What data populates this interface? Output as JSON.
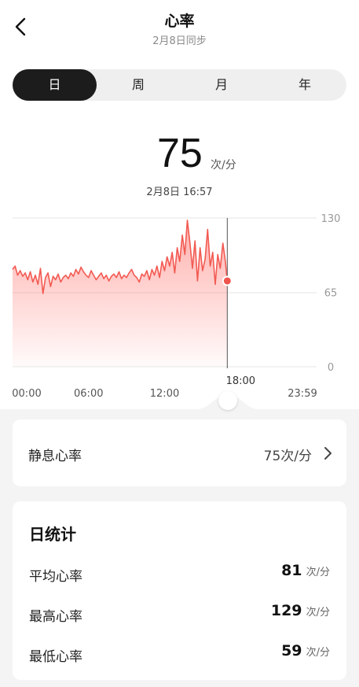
{
  "header": {
    "title": "心率",
    "subtitle": "2月8日同步"
  },
  "tabs": [
    {
      "label": "日",
      "active": true
    },
    {
      "label": "周",
      "active": false
    },
    {
      "label": "月",
      "active": false
    },
    {
      "label": "年",
      "active": false
    }
  ],
  "current": {
    "value": "75",
    "unit": "次/分",
    "time": "2月8日 16:57"
  },
  "chart_data": {
    "type": "area",
    "ylim": [
      0,
      130
    ],
    "y_ticks": [
      "130",
      "65",
      "0"
    ],
    "x_ticks": [
      "00:00",
      "06:00",
      "12:00",
      "23:59"
    ],
    "cursor_label": "18:00",
    "x_range_hours": [
      0,
      24
    ],
    "x": [
      0.0,
      0.2,
      0.4,
      0.6,
      0.8,
      1.0,
      1.2,
      1.4,
      1.6,
      1.8,
      2.0,
      2.2,
      2.4,
      2.6,
      2.8,
      3.0,
      3.2,
      3.4,
      3.6,
      3.8,
      4.0,
      4.2,
      4.4,
      4.6,
      4.8,
      5.0,
      5.2,
      5.4,
      5.6,
      5.8,
      6.0,
      6.2,
      6.4,
      6.6,
      6.8,
      7.0,
      7.2,
      7.4,
      7.6,
      7.8,
      8.0,
      8.2,
      8.4,
      8.6,
      8.8,
      9.0,
      9.2,
      9.4,
      9.6,
      9.8,
      10.0,
      10.2,
      10.4,
      10.6,
      10.8,
      11.0,
      11.2,
      11.4,
      11.6,
      11.8,
      12.0,
      12.2,
      12.4,
      12.6,
      12.8,
      13.0,
      13.2,
      13.4,
      13.6,
      13.8,
      14.0,
      14.2,
      14.4,
      14.6,
      14.8,
      15.0,
      15.2,
      15.4,
      15.6,
      15.8,
      16.0,
      16.2,
      16.4,
      16.6,
      16.8,
      16.95
    ],
    "y": [
      85,
      88,
      80,
      84,
      79,
      82,
      76,
      83,
      74,
      80,
      72,
      86,
      64,
      78,
      82,
      70,
      79,
      76,
      81,
      74,
      78,
      80,
      77,
      82,
      79,
      85,
      81,
      87,
      83,
      80,
      78,
      84,
      80,
      76,
      79,
      82,
      77,
      80,
      75,
      79,
      81,
      78,
      83,
      77,
      80,
      78,
      82,
      85,
      80,
      78,
      74,
      81,
      79,
      84,
      76,
      85,
      80,
      88,
      78,
      92,
      84,
      96,
      88,
      100,
      82,
      104,
      92,
      115,
      98,
      128,
      108,
      86,
      110,
      75,
      104,
      84,
      94,
      120,
      88,
      100,
      72,
      98,
      86,
      108,
      92,
      75
    ]
  },
  "resting": {
    "label": "静息心率",
    "value": "75次/分"
  },
  "stats": {
    "title": "日统计",
    "rows": [
      {
        "name": "平均心率",
        "value": "81",
        "unit": "次/分"
      },
      {
        "name": "最高心率",
        "value": "129",
        "unit": "次/分"
      },
      {
        "name": "最低心率",
        "value": "59",
        "unit": "次/分"
      }
    ]
  }
}
